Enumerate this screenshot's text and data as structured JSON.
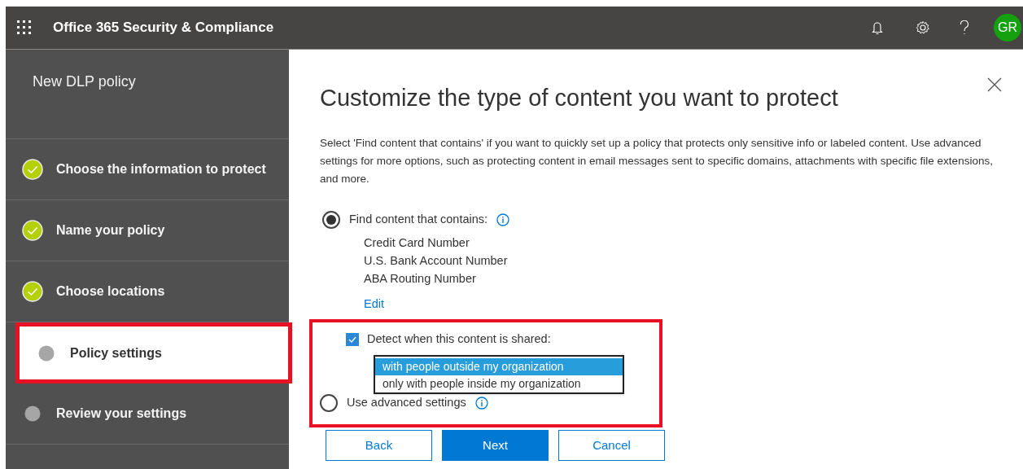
{
  "header": {
    "title": "Office 365 Security & Compliance",
    "avatar": "GR"
  },
  "sidebar": {
    "title": "New DLP policy",
    "steps": [
      {
        "label": "Choose the information to protect",
        "completed": true,
        "selected": false
      },
      {
        "label": "Name your policy",
        "completed": true,
        "selected": false
      },
      {
        "label": "Choose locations",
        "completed": true,
        "selected": false
      },
      {
        "label": "Policy settings",
        "completed": false,
        "selected": true
      },
      {
        "label": "Review your settings",
        "completed": false,
        "selected": false
      }
    ]
  },
  "main": {
    "title": "Customize the type of content you want to protect",
    "description": "Select 'Find content that contains' if you want to quickly set up a policy that protects only sensitive info or labeled content. Use advanced settings for more options, such as protecting content in email messages sent to specific domains, attachments with specific file extensions, and more.",
    "find_option": {
      "label": "Find content that contains:",
      "selected": true,
      "items": [
        "Credit Card Number",
        "U.S. Bank Account Number",
        "ABA Routing Number"
      ],
      "edit_link": "Edit"
    },
    "detect": {
      "label": "Detect when this content is shared:",
      "checked": true,
      "options": [
        {
          "label": "with people outside my organization",
          "selected": true
        },
        {
          "label": "only with people inside my organization",
          "selected": false
        }
      ]
    },
    "advanced_option": {
      "label": "Use advanced settings",
      "selected": false
    },
    "buttons": [
      {
        "label": "Back",
        "kind": "secondary"
      },
      {
        "label": "Next",
        "kind": "primary"
      },
      {
        "label": "Cancel",
        "kind": "secondary"
      }
    ]
  }
}
